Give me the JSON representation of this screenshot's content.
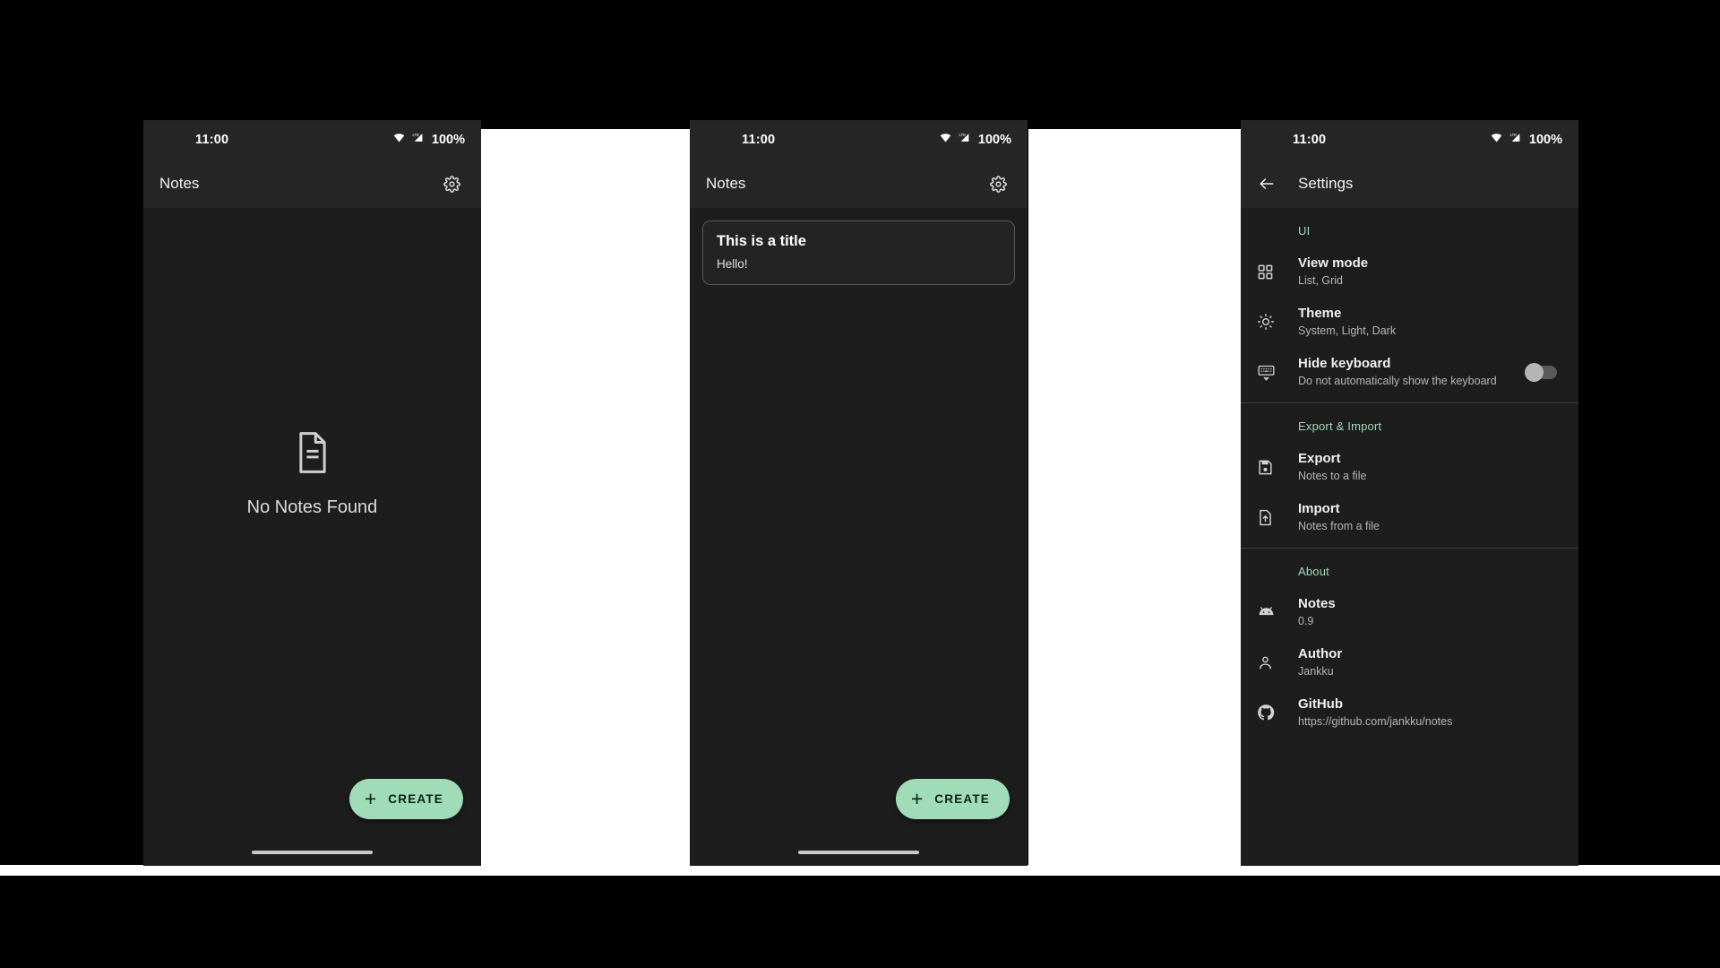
{
  "statusbar": {
    "time": "11:00",
    "battery": "100%",
    "wifi_icon": "wifi-icon",
    "signal_icon": "lte-signal-icon"
  },
  "phone1": {
    "appbar": {
      "title": "Notes",
      "settings_icon": "gear-icon"
    },
    "empty_state": {
      "icon": "document-icon",
      "text": "No Notes Found"
    },
    "fab": {
      "plus": "+",
      "label": "CREATE"
    }
  },
  "phone2": {
    "appbar": {
      "title": "Notes",
      "settings_icon": "gear-icon"
    },
    "notes": [
      {
        "title": "This is a title",
        "body": "Hello!"
      }
    ],
    "fab": {
      "plus": "+",
      "label": "CREATE"
    }
  },
  "phone3": {
    "appbar": {
      "title": "Settings",
      "back_icon": "arrow-back-icon"
    },
    "sections": [
      {
        "header": "UI",
        "items": [
          {
            "icon": "grid-view-icon",
            "title": "View mode",
            "summary": "List, Grid"
          },
          {
            "icon": "brightness-sun-icon",
            "title": "Theme",
            "summary": "System, Light, Dark"
          },
          {
            "icon": "keyboard-hide-icon",
            "title": "Hide keyboard",
            "summary": "Do not automatically show the keyboard",
            "toggle": "off"
          }
        ]
      },
      {
        "header": "Export & Import",
        "items": [
          {
            "icon": "save-floppy-icon",
            "title": "Export",
            "summary": "Notes to a file"
          },
          {
            "icon": "file-upload-icon",
            "title": "Import",
            "summary": "Notes from a file"
          }
        ]
      },
      {
        "header": "About",
        "items": [
          {
            "icon": "android-icon",
            "title": "Notes",
            "summary": "0.9"
          },
          {
            "icon": "person-icon",
            "title": "Author",
            "summary": "Jankku"
          },
          {
            "icon": "github-icon",
            "title": "GitHub",
            "summary": "https://github.com/jankku/notes"
          }
        ]
      }
    ]
  },
  "colors": {
    "accent_mint": "#9fdcb7",
    "surface": "#1d1d1d",
    "bar": "#262626",
    "page_background": "#000000",
    "gap_panel": "#ffffff"
  }
}
